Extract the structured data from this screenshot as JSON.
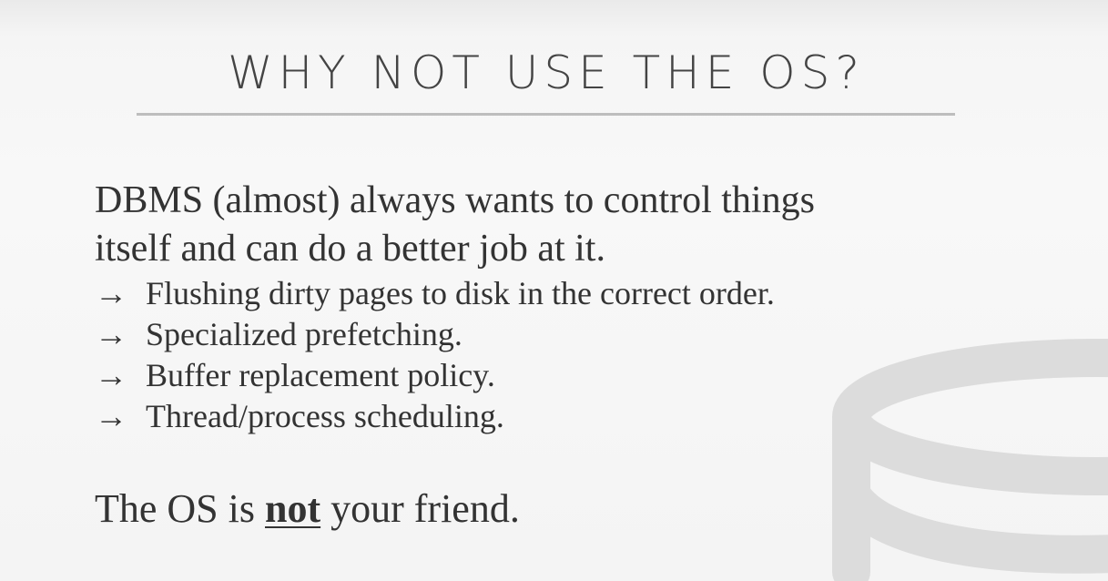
{
  "slide": {
    "title": "WHY NOT USE THE OS?",
    "lead_line_1": "DBMS (almost) always wants to control things",
    "lead_line_2": "itself and can do a better job at it.",
    "bullets": [
      {
        "arrow": "→",
        "text": "Flushing dirty pages to disk in the correct order."
      },
      {
        "arrow": "→",
        "text": "Specialized prefetching."
      },
      {
        "arrow": "→",
        "text": "Buffer replacement policy."
      },
      {
        "arrow": "→",
        "text": "Thread/process scheduling."
      }
    ],
    "closing": {
      "before": "The OS is ",
      "emphasis": "not",
      "after": " your friend."
    }
  },
  "watermark": {
    "icon": "database-icon",
    "color": "#dcdcdc"
  }
}
